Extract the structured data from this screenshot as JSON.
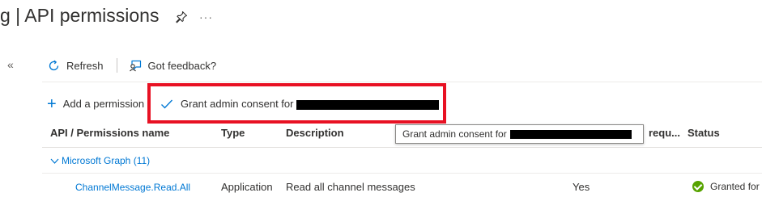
{
  "page": {
    "title": "g | API permissions"
  },
  "title_icons": [
    "pin-icon",
    "more-icon"
  ],
  "toolbar": {
    "refresh_label": "Refresh",
    "feedback_label": "Got feedback?"
  },
  "actions": {
    "add_permission_label": "Add a permission",
    "grant_consent_label": "Grant admin consent for"
  },
  "table": {
    "headers": {
      "name": "API / Permissions name",
      "type": "Type",
      "description": "Description",
      "admin_required": "requ...",
      "status": "Status"
    },
    "tooltip": "Grant admin consent for",
    "groups": [
      {
        "label": "Microsoft Graph (11)",
        "rows": [
          {
            "name": "ChannelMessage.Read.All",
            "type": "Application",
            "description": "Read all channel messages",
            "admin_required": "Yes",
            "status": "Granted for"
          }
        ]
      }
    ]
  },
  "colors": {
    "accent": "#0078d4",
    "highlight_border": "#e81123",
    "granted": "#57a300"
  }
}
